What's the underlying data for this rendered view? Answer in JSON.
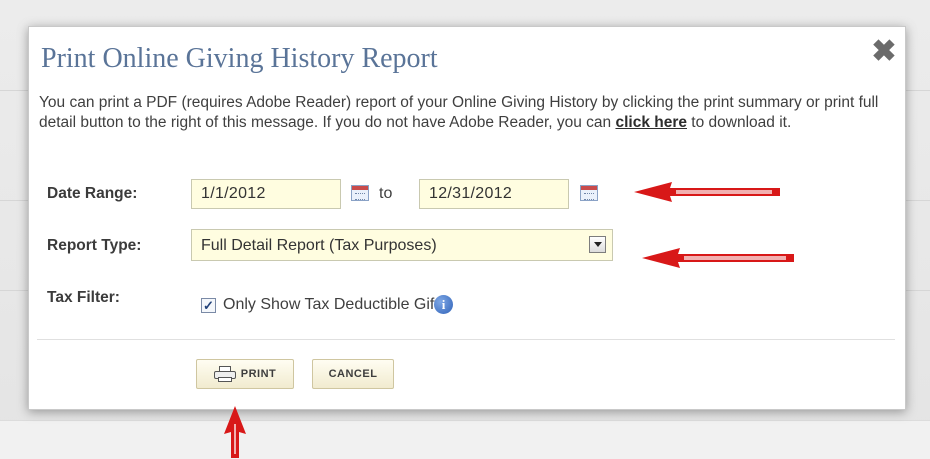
{
  "dialog": {
    "title": "Print Online Giving History Report",
    "close_symbol": "✖",
    "intro_part1": "You can print a PDF (requires Adobe Reader) report of your Online Giving History by clicking the print summary or print full detail button to the right of this message. If you do not have Adobe Reader, you can ",
    "intro_link": "click here",
    "intro_part2": " to download it."
  },
  "form": {
    "date_range_label": "Date Range:",
    "start_date": "1/1/2012",
    "to_text": "to",
    "end_date": "12/31/2012",
    "report_type_label": "Report Type:",
    "report_type_selected": "Full Detail Report (Tax Purposes)",
    "tax_filter_label": "Tax Filter:",
    "tax_filter_checked": true,
    "tax_filter_option": "Only Show Tax Deductible Gifts",
    "info_symbol": "i"
  },
  "buttons": {
    "print_label": "PRINT",
    "cancel_label": "CANCEL"
  },
  "icons": {
    "close": "close-icon",
    "calendar": "calendar-icon",
    "dropdown": "chevron-down-icon",
    "info": "info-icon",
    "printer": "printer-icon",
    "annotation": "red-arrow"
  },
  "colors": {
    "title": "#5a7498",
    "input_background": "#fffde0",
    "button_background": "#f1ebcf",
    "annotation_arrow": "#d81818",
    "info_icon": "#2f62b8"
  }
}
